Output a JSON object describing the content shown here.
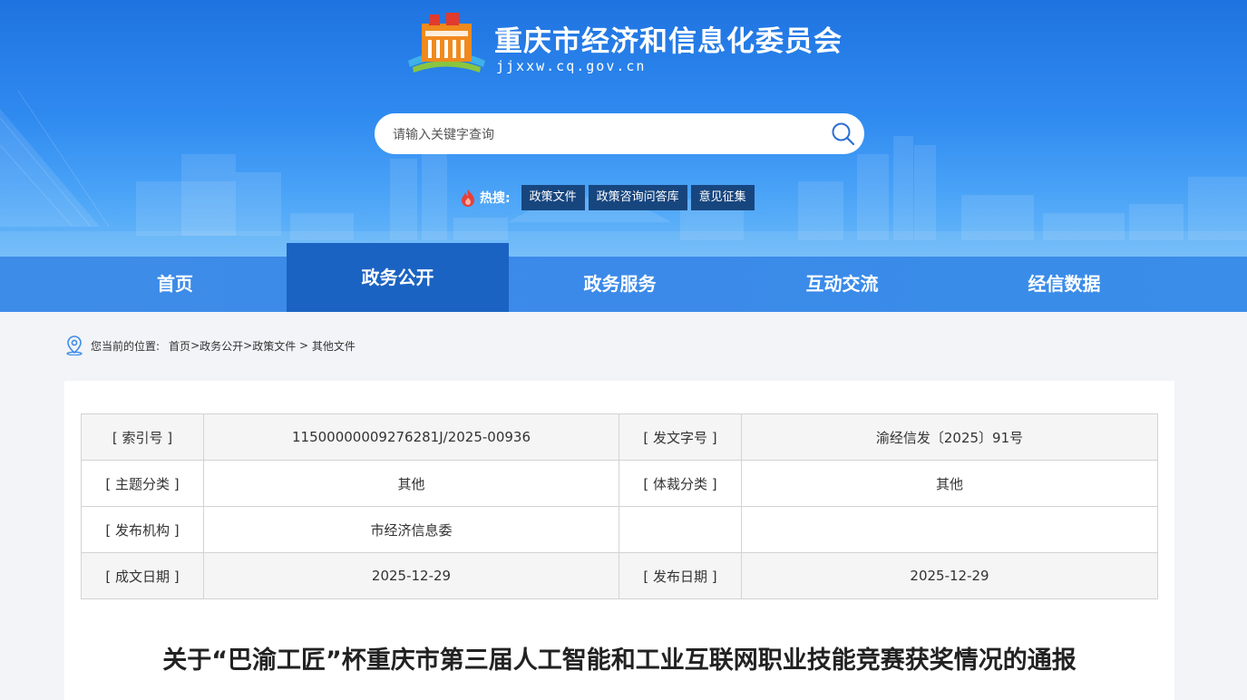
{
  "site": {
    "title": "重庆市经济和信息化委员会",
    "domain": "jjxxw.cq.gov.cn"
  },
  "search": {
    "placeholder": "请输入关键字查询"
  },
  "hot_search": {
    "label": "热搜:",
    "tags": [
      "政策文件",
      "政策咨询问答库",
      "意见征集"
    ]
  },
  "nav": {
    "items": [
      "首页",
      "政务公开",
      "政务服务",
      "互动交流",
      "经信数据"
    ],
    "active": "政务公开"
  },
  "breadcrumb": {
    "prefix": "您当前的位置:",
    "items": [
      "首页",
      "政务公开",
      "政策文件",
      "其他文件"
    ],
    "separators": [
      ">",
      ">",
      " > "
    ]
  },
  "meta_table": {
    "rows": [
      [
        "[ 索引号 ]",
        "11500000009276281J/2025-00936",
        "[ 发文字号 ]",
        "渝经信发〔2025〕91号"
      ],
      [
        "[ 主题分类 ]",
        "其他",
        "[ 体裁分类 ]",
        "其他"
      ],
      [
        "[ 发布机构 ]",
        "市经济信息委",
        "",
        ""
      ],
      [
        "[ 成文日期 ]",
        "2025-12-29",
        "[ 发布日期 ]",
        "2025-12-29"
      ]
    ]
  },
  "document": {
    "title": "关于“巴渝工匠”杯重庆市第三届人工智能和工业互联网职业技能竞赛获奖情况的通报"
  },
  "colors": {
    "header_top": "#1f73e0",
    "nav_active": "#1b63c2",
    "hot_tag_bg": "#17467f"
  }
}
